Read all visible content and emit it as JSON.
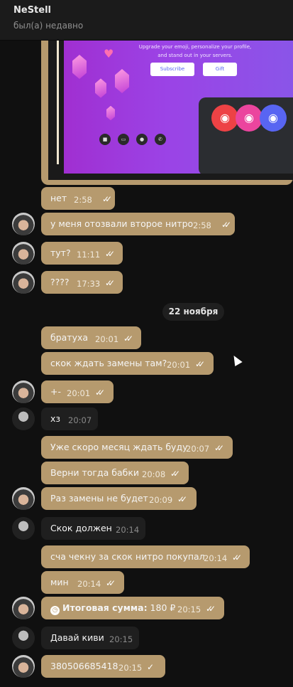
{
  "header": {
    "name": "NeStell",
    "status": "был(а) недавно"
  },
  "image_message": {
    "promo_line1": "Upgrade your emoji, personalize your profile,",
    "promo_line2": "and stand out in your servers.",
    "subscribe": "Subscribe",
    "gift": "Gift"
  },
  "date_separator": "22 ноября",
  "messages": [
    {
      "text": "нет",
      "time": "2:58",
      "dir": "out",
      "read": true
    },
    {
      "text": "у меня отозвали второе нитро",
      "time": "2:58",
      "dir": "out",
      "read": true
    },
    {
      "text": "тут?",
      "time": "11:11",
      "dir": "out",
      "read": true
    },
    {
      "text": "????",
      "time": "17:33",
      "dir": "out",
      "read": true
    },
    {
      "text": "братуха",
      "time": "20:01",
      "dir": "out",
      "read": true
    },
    {
      "text": "скок ждать замены там?",
      "time": "20:01",
      "dir": "out",
      "read": true
    },
    {
      "text": "+-",
      "time": "20:01",
      "dir": "out",
      "read": true
    },
    {
      "text": "хз",
      "time": "20:07",
      "dir": "in"
    },
    {
      "text": "Уже скоро месяц ждать буду",
      "time": "20:07",
      "dir": "out",
      "read": true
    },
    {
      "text": "Верни тогда бабки",
      "time": "20:08",
      "dir": "out",
      "read": true
    },
    {
      "text": "Раз замены не будет",
      "time": "20:09",
      "dir": "out",
      "read": true
    },
    {
      "text": "Скок должен",
      "time": "20:14",
      "dir": "in"
    },
    {
      "text": "сча чекну за скок нитро покупал",
      "time": "20:14",
      "dir": "out",
      "read": true
    },
    {
      "text": "мин",
      "time": "20:14",
      "dir": "out",
      "read": true
    },
    {
      "label": "Итоговая сумма:",
      "amount": "180 ₽",
      "time": "20:15",
      "dir": "out",
      "read": true
    },
    {
      "text": "Давай киви",
      "time": "20:15",
      "dir": "in"
    },
    {
      "text": "380506685418",
      "time": "20:15",
      "dir": "out",
      "read": false
    }
  ],
  "colors": {
    "outgoing_bubble": "#b69a6e",
    "incoming_bubble": "#1f1f1f",
    "background": "#101010"
  }
}
